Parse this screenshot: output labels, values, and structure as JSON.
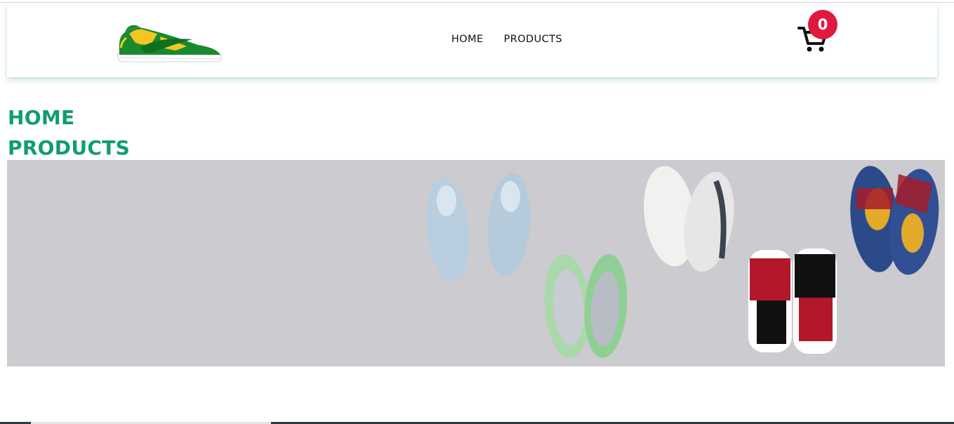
{
  "header": {
    "logo": {
      "icon": "sneaker-logo-icon"
    },
    "nav": [
      {
        "label": "HOME"
      },
      {
        "label": "PRODUCTS"
      }
    ],
    "cart": {
      "icon": "shopping-cart-icon",
      "count": "0"
    }
  },
  "sidebar_links": [
    {
      "label": "HOME"
    },
    {
      "label": "PRODUCTS"
    }
  ],
  "hero": {
    "image": "sneakers-collection-banner"
  },
  "colors": {
    "accent_green": "#0f9e6a",
    "badge_red": "#e0193e",
    "hero_bg": "#cbcbd0"
  }
}
